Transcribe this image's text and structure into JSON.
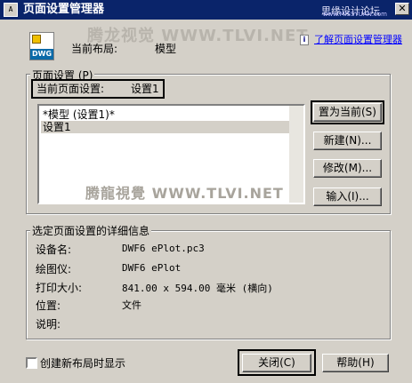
{
  "window": {
    "title": "页面设置管理器",
    "app_icon_text": "A",
    "watermark_top": "思缘设计论坛",
    "watermark_url": "www.MISSYUAN.com",
    "close_glyph": "✕"
  },
  "header": {
    "icon_tag": "DWG",
    "layout_label": "当前布局:",
    "layout_value": "模型",
    "watermark_mid": "腾龙视觉 WWW.TLVI.NET",
    "help_link": "了解页面设置管理器"
  },
  "page_setup": {
    "legend": "页面设置 (P)",
    "current_label": "当前页面设置:",
    "current_value": "设置1",
    "items": [
      {
        "label": "*模型 (设置1)*",
        "selected": false
      },
      {
        "label": "设置1",
        "selected": true
      }
    ],
    "buttons": {
      "set_current": "置为当前(S)",
      "new": "新建(N)...",
      "modify": "修改(M)...",
      "import": "输入(I)..."
    }
  },
  "details": {
    "legend": "选定页面设置的详细信息",
    "watermark": "腾龍視覺 WWW.TLVI.NET",
    "rows": [
      {
        "label": "设备名:",
        "value": "DWF6 ePlot.pc3"
      },
      {
        "label": "绘图仪:",
        "value": "DWF6 ePlot"
      },
      {
        "label": "打印大小:",
        "value": "841.00 x 594.00 毫米 (横向)"
      },
      {
        "label": "位置:",
        "value": "文件"
      },
      {
        "label": "说明:",
        "value": ""
      }
    ]
  },
  "footer": {
    "checkbox_label": "创建新布局时显示",
    "checkbox_checked": false,
    "close_button": "关闭(C)",
    "help_button": "帮助(H)"
  }
}
